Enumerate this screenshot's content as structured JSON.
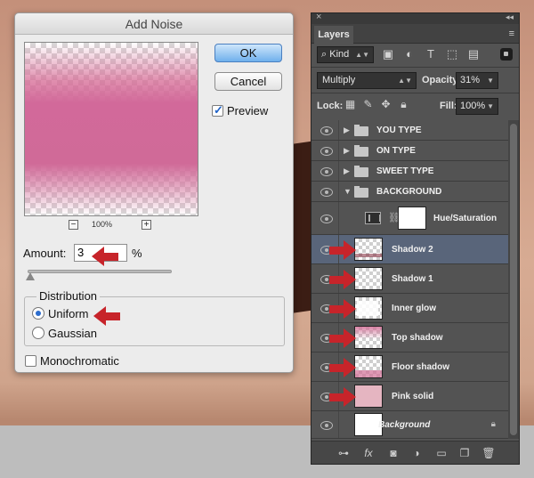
{
  "dialog": {
    "title": "Add Noise",
    "ok_label": "OK",
    "cancel_label": "Cancel",
    "preview_label": "Preview",
    "preview_checked": true,
    "zoom_minus": "−",
    "zoom_plus": "+",
    "zoom_level": "100%",
    "amount_label": "Amount:",
    "amount_value": "3",
    "amount_unit": "%",
    "distribution_label": "Distribution",
    "uniform_label": "Uniform",
    "gaussian_label": "Gaussian",
    "selected_distribution": "Uniform",
    "monochromatic_label": "Monochromatic",
    "monochromatic_checked": false
  },
  "layers_panel": {
    "tab_label": "Layers",
    "close_glyph": "×",
    "collapse_glyph": "◂◂",
    "menu_glyph": "≡",
    "filter_kind": "Kind",
    "filter_kind_glyph": "⌕",
    "blend_mode": "Multiply",
    "opacity_label": "Opacity:",
    "opacity_value": "31%",
    "lock_label": "Lock:",
    "fill_label": "Fill:",
    "fill_value": "100%",
    "filter_icons": [
      "image-icon",
      "adjustment-icon",
      "type-icon",
      "shape-icon",
      "smart-object-icon"
    ],
    "lock_icons": [
      "lock-transparent-icon",
      "lock-image-icon",
      "lock-position-icon",
      "lock-all-icon"
    ],
    "layers": [
      {
        "name": "YOU TYPE",
        "kind": "group",
        "expanded": false
      },
      {
        "name": "ON TYPE",
        "kind": "group",
        "expanded": false
      },
      {
        "name": "SWEET TYPE",
        "kind": "group",
        "expanded": false
      },
      {
        "name": "BACKGROUND",
        "kind": "group",
        "expanded": true
      },
      {
        "name": "Hue/Saturation",
        "kind": "adjustment"
      },
      {
        "name": "Shadow 2",
        "kind": "pixel",
        "selected": true
      },
      {
        "name": "Shadow 1",
        "kind": "pixel"
      },
      {
        "name": "Inner glow",
        "kind": "pixel"
      },
      {
        "name": "Top shadow",
        "kind": "pixel"
      },
      {
        "name": "Floor shadow",
        "kind": "pixel"
      },
      {
        "name": "Pink solid",
        "kind": "pixel"
      },
      {
        "name": "Background",
        "kind": "background",
        "locked": true
      }
    ],
    "bottom_icons": [
      "link-icon",
      "fx-icon",
      "mask-icon",
      "adjustment-layer-icon",
      "new-group-icon",
      "new-layer-icon",
      "trash-icon"
    ]
  },
  "colors": {
    "accent_arrow": "#c7242a",
    "selected_row": "#59657a",
    "panel_bg": "#535353"
  }
}
